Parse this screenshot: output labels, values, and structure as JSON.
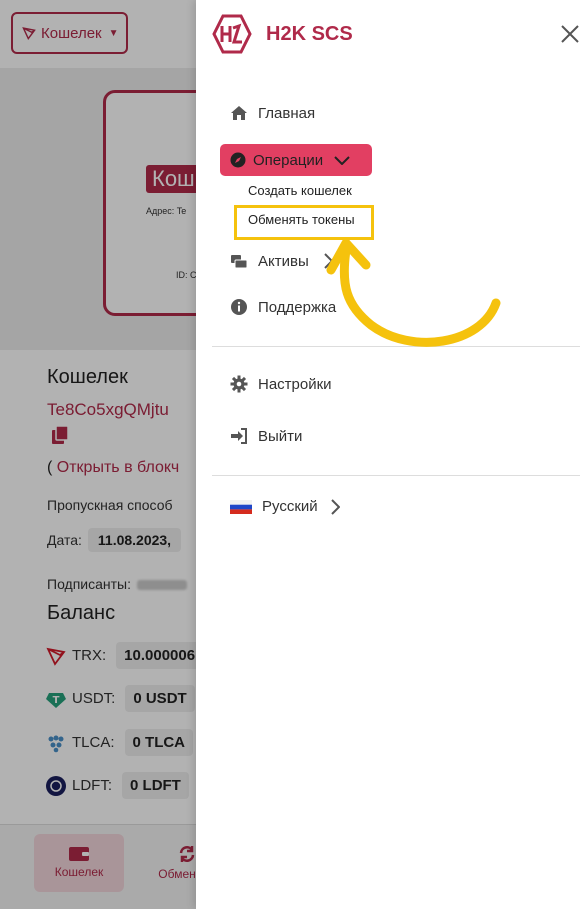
{
  "background": {
    "wallet_button_label": "Кошелек",
    "card": {
      "badge": "Кош",
      "address_label": "Адрес: Te",
      "id_label": "ID: C"
    },
    "wallet_title": "Кошелек",
    "wallet_address": "Te8Co5xgQMjtu",
    "open_text_prefix": "( ",
    "open_link": "Открыть в блокч",
    "bandwidth_label": "Пропускная способ",
    "date_label": "Дата:",
    "date_value": "11.08.2023,",
    "signers_label": "Подписанты:",
    "balance_title": "Баланс",
    "tokens": [
      {
        "symbol": "TRX:",
        "value": "10.000006"
      },
      {
        "symbol": "USDT:",
        "value": "0 USDT"
      },
      {
        "symbol": "TLCA:",
        "value": "0 TLCA"
      },
      {
        "symbol": "LDFT:",
        "value": "0 LDFT"
      }
    ],
    "nav": {
      "wallet": "Кошелек",
      "exchange": "Обмен"
    }
  },
  "drawer": {
    "brand": "H2K SCS",
    "menu": {
      "home": "Главная",
      "operations": "Операции",
      "create_wallet": "Создать кошелек",
      "swap_tokens": "Обменять токены",
      "assets": "Активы",
      "support": "Поддержка",
      "settings": "Настройки",
      "logout": "Выйти",
      "language": "Русский"
    }
  },
  "colors": {
    "brand": "#b02a4a",
    "active_item": "#e23f62",
    "highlight": "#f5c20d"
  },
  "icons": [
    "home-icon",
    "compass-icon",
    "chevron-down-icon",
    "assets-icon",
    "chevron-right-icon",
    "info-icon",
    "gear-icon",
    "logout-icon",
    "flag-ru-icon",
    "close-icon",
    "copy-icon",
    "wallet-icon",
    "exchange-icon"
  ]
}
